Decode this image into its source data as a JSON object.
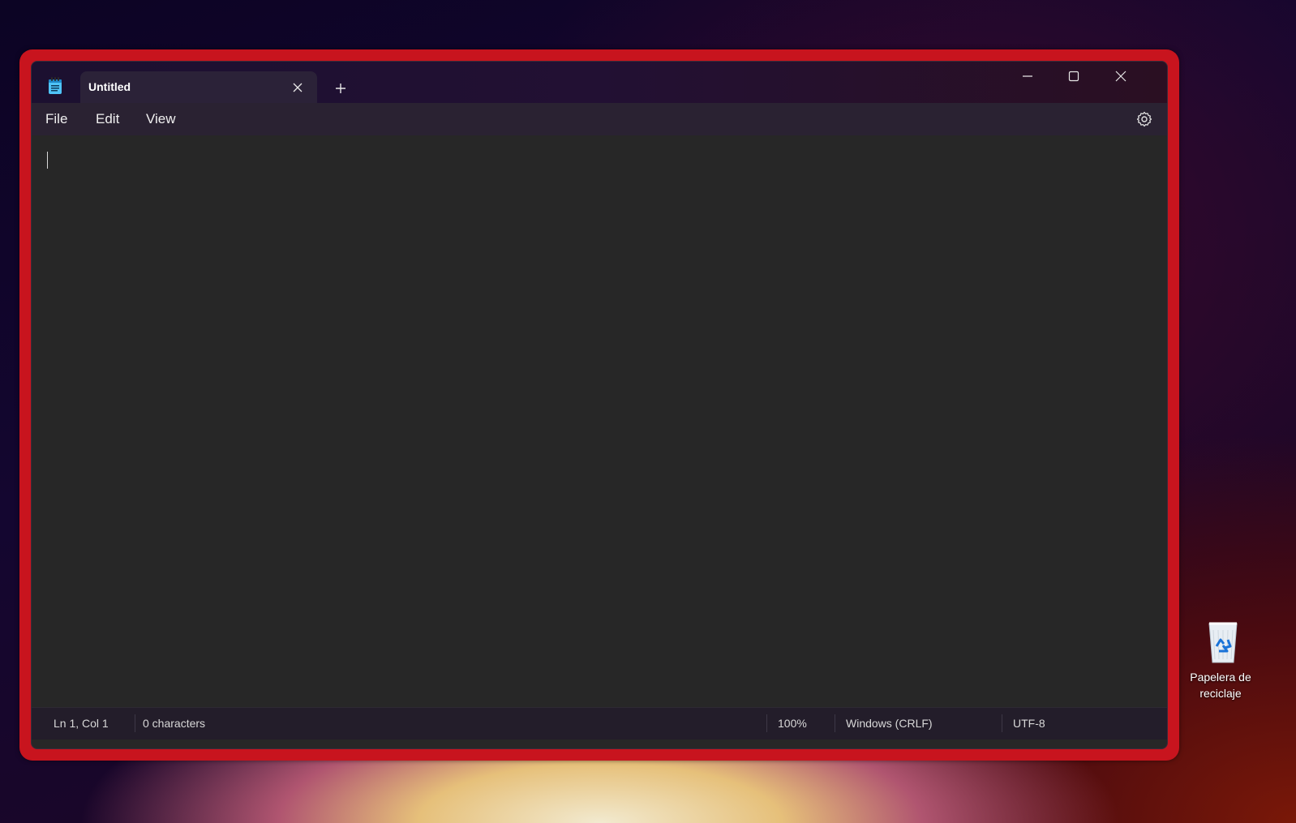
{
  "window": {
    "tab_title": "Untitled",
    "menu": {
      "file": "File",
      "edit": "Edit",
      "view": "View"
    },
    "editor": {
      "content": ""
    },
    "status": {
      "position": "Ln 1, Col 1",
      "characters": "0 characters",
      "zoom": "100%",
      "line_ending": "Windows (CRLF)",
      "encoding": "UTF-8"
    }
  },
  "desktop": {
    "recycle_bin_label": "Papelera de\nreciclaje"
  },
  "icons": {
    "app": "notepad-icon",
    "tab_close": "close-icon",
    "new_tab": "plus-icon",
    "minimize": "minimize-icon",
    "maximize": "maximize-icon",
    "close": "close-icon",
    "settings": "gear-icon",
    "recycle_bin": "recycle-bin-icon"
  },
  "colors": {
    "highlight_frame": "#c8141e",
    "editor_background": "#272727",
    "app_icon": "#4fc3f7"
  }
}
